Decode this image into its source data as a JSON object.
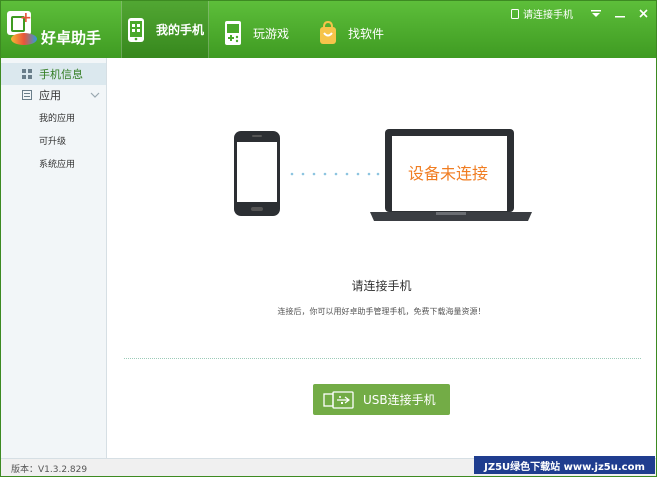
{
  "app": {
    "name": "好卓助手",
    "version_text": "版本：V1.3.2.829"
  },
  "header": {
    "tabs": [
      {
        "label": "我的手机",
        "icon": "phone-icon",
        "active": true
      },
      {
        "label": "玩游戏",
        "icon": "gamepad-icon",
        "active": false
      },
      {
        "label": "找软件",
        "icon": "bag-icon",
        "active": false
      }
    ],
    "connect_phone_link": "请连接手机",
    "accent_color": "#4cae2c"
  },
  "sidebar": {
    "items": [
      {
        "label": "手机信息",
        "icon": "info-grid-icon",
        "active": true
      },
      {
        "label": "应用",
        "icon": "apps-icon",
        "active": false
      }
    ],
    "subitems": [
      "我的应用",
      "可升级",
      "系统应用"
    ]
  },
  "main": {
    "status_label": "设备未连接",
    "title": "请连接手机",
    "description": "连接后，你可以用好卓助手管理手机，免费下载海量资源！",
    "usb_button": "USB连接手机",
    "status_color": "#f07d22"
  },
  "watermark": "JZ5U绿色下载站 www.jz5u.com"
}
